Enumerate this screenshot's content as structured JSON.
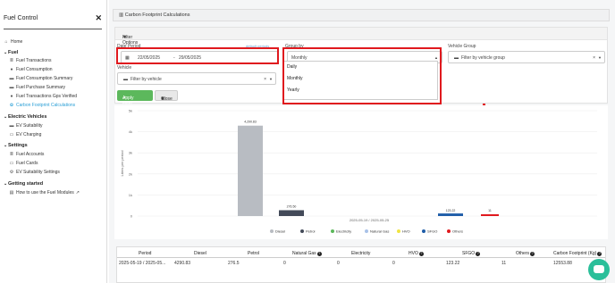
{
  "sidebar": {
    "title": "Fuel Control",
    "close_label": "✕",
    "home": "Home",
    "sections": [
      {
        "label": "Fuel",
        "items": [
          "Fuel Transactions",
          "Fuel Consumption",
          "Fuel Consumption Summary",
          "Fuel Purchase Summary",
          "Fuel Transactions Gps Verified",
          "Carbon Footprint Calculations"
        ]
      },
      {
        "label": "Electric Vehicles",
        "items": [
          "EV Suitability",
          "EV Charging"
        ]
      },
      {
        "label": "Settings",
        "items": [
          "Fuel Accounts",
          "Fuel Cards",
          "EV Suitability Settings"
        ]
      },
      {
        "label": "Getting started",
        "items": [
          "How to use the Fuel Modules"
        ]
      }
    ],
    "active_item": "Carbon Footprint Calculations"
  },
  "header": {
    "title": "Carbon Footprint Calculations"
  },
  "filters": {
    "title": "Filter Options",
    "date_period_label": "Date Period",
    "default_periods_link": "default periods",
    "date_from": "22/05/2025",
    "date_sep": "-",
    "date_to": "29/05/2025",
    "group_by_label": "Group by",
    "group_by_value": "Monthly",
    "group_by_options": [
      "Daily",
      "Monthly",
      "Yearly"
    ],
    "vehicle_group_label": "Vehicle Group",
    "vehicle_group_placeholder": "Filter by vehicle group",
    "vehicle_label": "Vehicle",
    "vehicle_placeholder": "Filter by vehicle",
    "apply_label": "Apply Filter",
    "close_label": "Close"
  },
  "chart_data": {
    "type": "bar",
    "categories": [
      "2025-05-19 / 2025-05-25"
    ],
    "y_ticks": [
      "5k",
      "4k",
      "3k",
      "2k",
      "1k",
      "0"
    ],
    "ylabel": "Liters per period",
    "ylim": [
      0,
      5000
    ],
    "series": [
      {
        "name": "Diesel",
        "values": [
          4290.83
        ],
        "color": "#b8bcc2"
      },
      {
        "name": "Petrol",
        "values": [
          276.5
        ],
        "color": "#434a59"
      },
      {
        "name": "Electricity",
        "values": [
          0
        ],
        "color": "#5cb85c"
      },
      {
        "name": "Natural Gas",
        "values": [
          0
        ],
        "color": "#a9c2e8"
      },
      {
        "name": "HVO",
        "values": [
          0
        ],
        "color": "#f0e442"
      },
      {
        "name": "SFGO",
        "values": [
          123.22
        ],
        "color": "#1f5da8"
      },
      {
        "name": "Others",
        "values": [
          11
        ],
        "color": "#e0191e"
      }
    ],
    "data_labels": [
      "4,290.83",
      "276.50",
      "123.22",
      "11"
    ]
  },
  "table": {
    "columns": [
      "Period",
      "Diesel",
      "Petrol",
      "Natural Gas",
      "Electricity",
      "HVO",
      "SFGO",
      "Others",
      "Carbon Footprint (Kg)"
    ],
    "rows": [
      [
        "2025-05-19 / 2025-05...",
        "4290.83",
        "276.5",
        "0",
        "0",
        "0",
        "123.22",
        "11",
        "12553.88"
      ]
    ]
  }
}
